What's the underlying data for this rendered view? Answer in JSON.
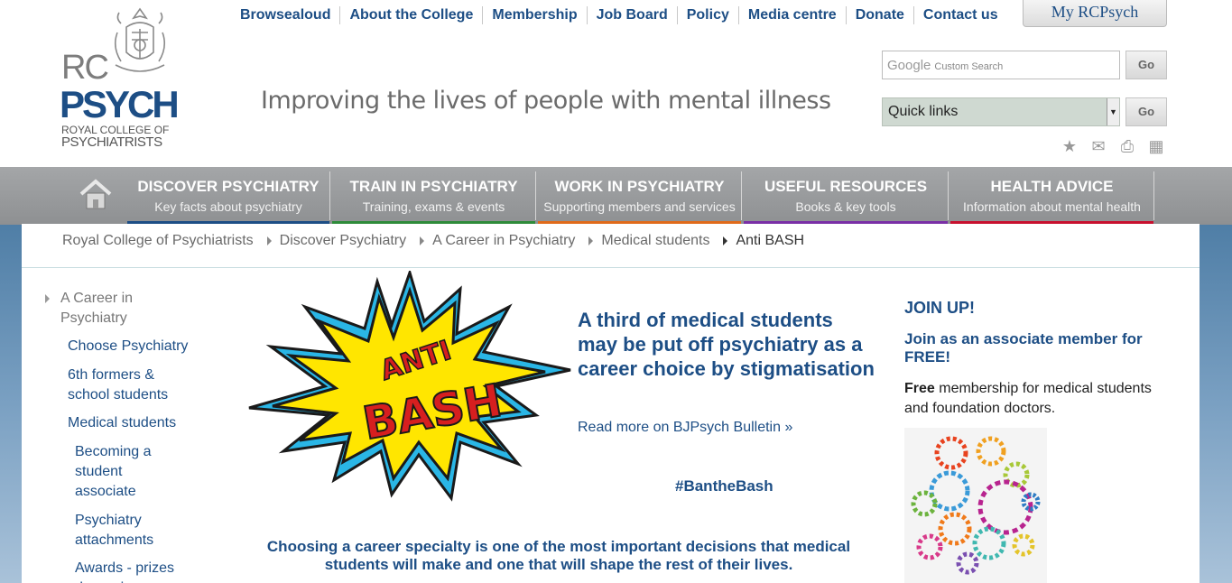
{
  "logo": {
    "rc": "RC",
    "psych": "PSYCH",
    "sub1": "ROYAL COLLEGE OF",
    "sub2": "PSYCHIATRISTS"
  },
  "topnav": [
    "Browsealoud",
    "About the College",
    "Membership",
    "Job Board",
    "Policy",
    "Media centre",
    "Donate",
    "Contact us"
  ],
  "my_rcpsych": "My RCPsych",
  "tagline": "Improving the lives of people with mental illness",
  "search": {
    "brand": "Google",
    "placeholder": "Custom Search",
    "go": "Go"
  },
  "quick_links": {
    "selected": "Quick links",
    "go": "Go"
  },
  "tool_icons": [
    "star-icon",
    "email-icon",
    "print-icon",
    "film-icon"
  ],
  "mainnav": [
    {
      "title": "DISCOVER PSYCHIATRY",
      "sub": "Key facts about psychiatry",
      "color": "#1d4e85"
    },
    {
      "title": "TRAIN IN PSYCHIATRY",
      "sub": "Training, exams & events",
      "color": "#2e8b3a"
    },
    {
      "title": "WORK IN PSYCHIATRY",
      "sub": "Supporting members and services",
      "color": "#e06a1a"
    },
    {
      "title": "USEFUL RESOURCES",
      "sub": "Books & key tools",
      "color": "#7a2fa6"
    },
    {
      "title": "HEALTH ADVICE",
      "sub": "Information about mental health",
      "color": "#c8102e"
    }
  ],
  "breadcrumb": [
    "Royal College of Psychiatrists",
    "Discover Psychiatry",
    "A Career in Psychiatry",
    "Medical students",
    "Anti BASH"
  ],
  "leftnav": {
    "head": "A Career in Psychiatry",
    "l1": [
      "Choose Psychiatry",
      "6th formers & school students",
      "Medical students"
    ],
    "l2": [
      "Becoming a student associate",
      "Psychiatry attachments",
      "Awards - prizes -bursaries"
    ]
  },
  "bash": {
    "anti": "ANTI",
    "bash": "BASH"
  },
  "headline": "A third of medical students may be put off psychiatry as a career choice by stigmatisation",
  "readmore": "Read more on BJPsych Bulletin »",
  "hashtag": "#BantheBash",
  "choose": "Choosing a career specialty is one of the most important decisions that medical students will make and one that will shape the rest of their lives.",
  "join": {
    "title": "JOIN UP!",
    "sub": "Join as an associate member for FREE!",
    "free_bold": "Free",
    "free_rest": " membership for medical students and foundation doctors."
  }
}
